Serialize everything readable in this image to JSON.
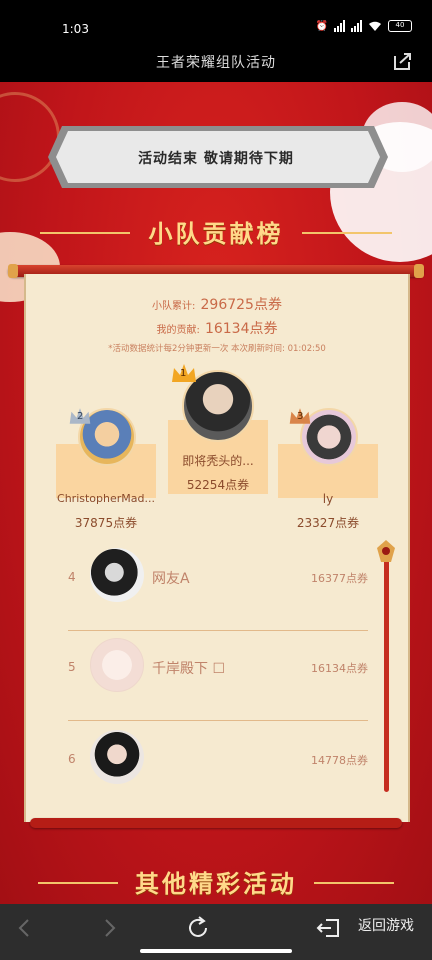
{
  "status": {
    "time": "1:03",
    "battery": "40"
  },
  "header": {
    "title": "王者荣耀组队活动"
  },
  "banner": {
    "text": "活动结束 敬请期待下期"
  },
  "leaderboard": {
    "title": "小队贡献榜",
    "team_total_label": "小队累计:",
    "team_total_value": "296725点券",
    "my_contrib_label": "我的贡献:",
    "my_contrib_value": "16134点券",
    "note": "*活动数据统计每2分钟更新一次 本次刷新时间: 01:02:50",
    "top3": [
      {
        "rank": "1",
        "name": "即将秃头的...",
        "score": "52254点券"
      },
      {
        "rank": "2",
        "name": "ChristopherMad...",
        "score": "37875点券"
      },
      {
        "rank": "3",
        "name": "ly",
        "score": "23327点券"
      }
    ],
    "rows": [
      {
        "rank": "4",
        "name": "网友A",
        "score": "16377点券"
      },
      {
        "rank": "5",
        "name": "千岸殿下 ☐",
        "score": "16134点券"
      },
      {
        "rank": "6",
        "name": "",
        "score": "14778点券"
      }
    ]
  },
  "other": {
    "title": "其他精彩活动"
  },
  "nav": {
    "return_label": "返回游戏"
  }
}
